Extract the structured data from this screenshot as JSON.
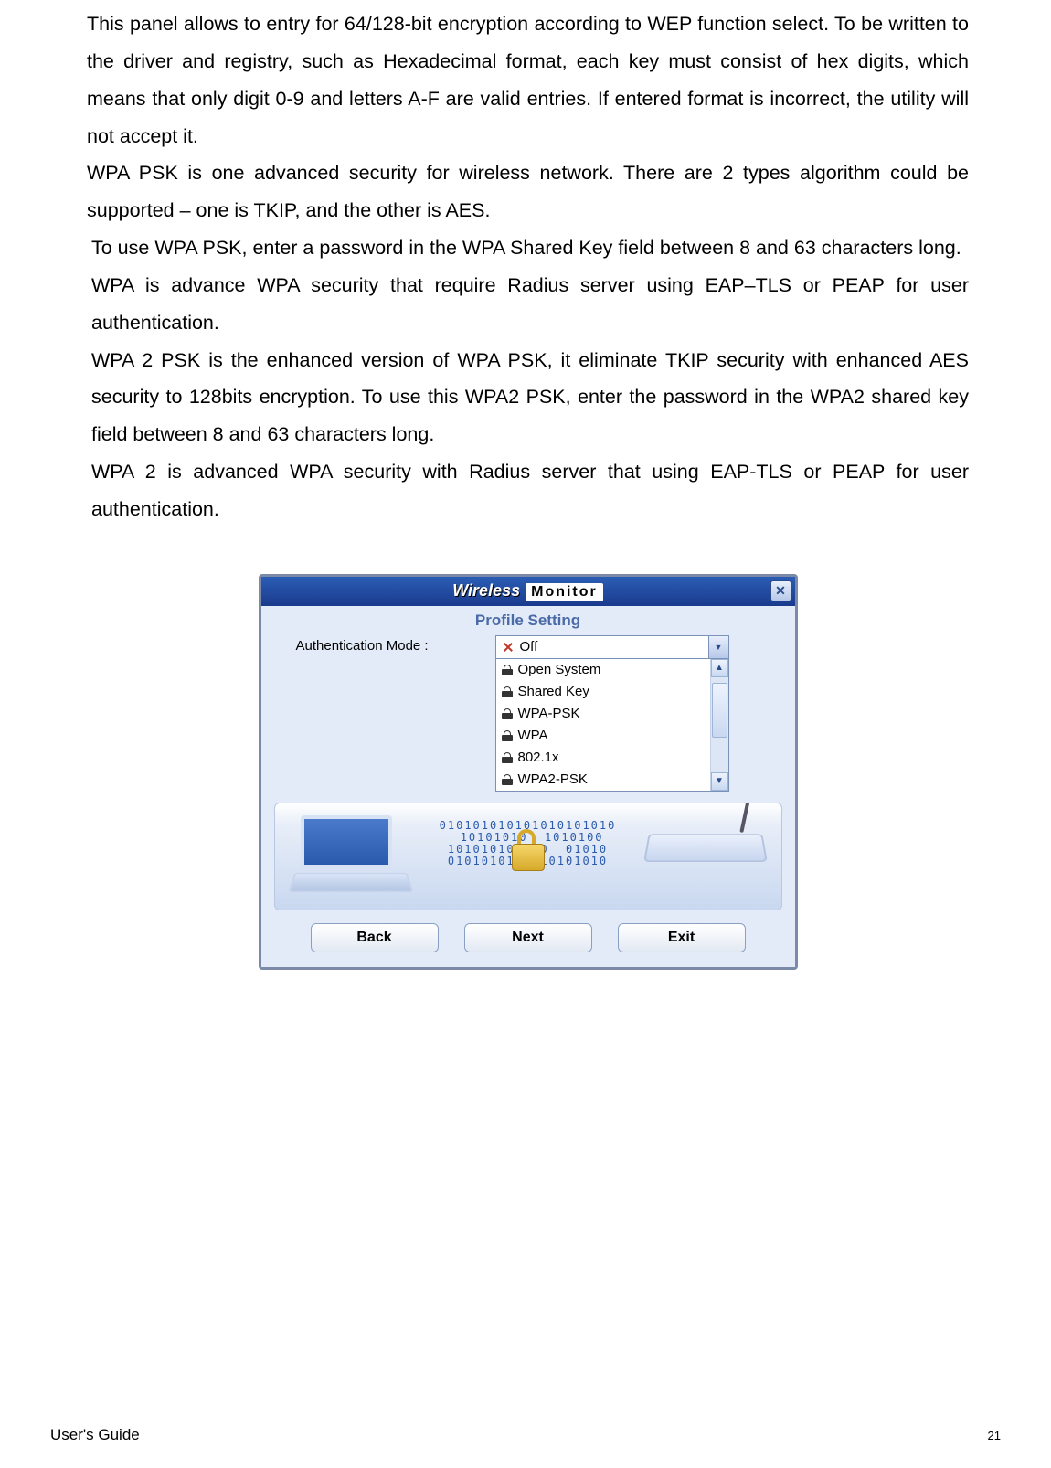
{
  "paragraphs": {
    "p1": "This panel allows to entry for 64/128-bit encryption according to WEP function select. To be written to the driver and registry, such as Hexadecimal format, each key must consist of hex digits, which means that only digit 0-9 and letters A-F are valid entries. If entered format is incorrect, the utility will not accept it.",
    "p2": "WPA PSK is one advanced security for wireless network. There are 2 types algorithm could be supported – one is TKIP, and the other is AES.",
    "p3": "To use WPA PSK, enter a password in the WPA Shared Key field between 8 and 63 characters long.",
    "p4": "WPA is advance WPA security that require Radius server using EAP–TLS or PEAP for user authentication.",
    "p5": "WPA 2 PSK is the enhanced version of WPA PSK, it eliminate TKIP security with enhanced AES security to 128bits encryption. To use this WPA2 PSK, enter the password in the WPA2 shared key field between 8 and 63 characters long.",
    "p6": "WPA 2 is advanced WPA security with Radius server that using EAP-TLS or PEAP for user authentication."
  },
  "window": {
    "title_brand": "Wireless",
    "title_app": "Monitor",
    "subtitle": "Profile Setting",
    "label": "Authentication Mode :",
    "selected": "Off",
    "options": [
      "Open System",
      "Shared Key",
      "WPA-PSK",
      "WPA",
      "802.1x",
      "WPA2-PSK"
    ],
    "bits": "010101010101010101010\n 10101010  1010100\n101010101010  01010\n0101010101010101010",
    "buttons": {
      "back": "Back",
      "next": "Next",
      "exit": "Exit"
    }
  },
  "footer": {
    "doc": "User's Guide",
    "page": "21"
  }
}
